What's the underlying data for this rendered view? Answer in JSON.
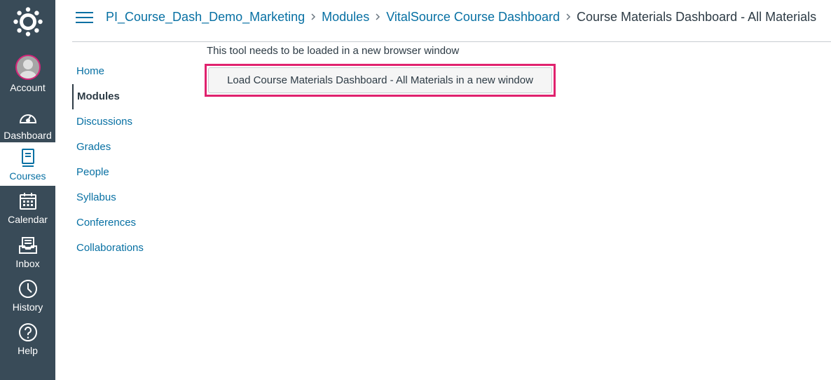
{
  "global_nav": {
    "items": [
      {
        "label": "Account",
        "icon": "avatar"
      },
      {
        "label": "Dashboard",
        "icon": "dashboard-icon"
      },
      {
        "label": "Courses",
        "icon": "courses-icon",
        "active": true
      },
      {
        "label": "Calendar",
        "icon": "calendar-icon"
      },
      {
        "label": "Inbox",
        "icon": "inbox-icon"
      },
      {
        "label": "History",
        "icon": "history-icon"
      },
      {
        "label": "Help",
        "icon": "help-icon"
      }
    ],
    "colors": {
      "background": "#394b58",
      "active_text": "#0770a3",
      "avatar_ring": "#d6257a"
    }
  },
  "breadcrumb": {
    "items": [
      "PI_Course_Dash_Demo_Marketing",
      "Modules",
      "VitalSource Course Dashboard"
    ],
    "current": "Course Materials Dashboard - All Materials"
  },
  "course_nav": {
    "items": [
      "Home",
      "Modules",
      "Discussions",
      "Grades",
      "People",
      "Syllabus",
      "Conferences",
      "Collaborations"
    ],
    "active": "Modules"
  },
  "main": {
    "message": "This tool needs to be loaded in a new browser window",
    "load_button_label": "Load Course Materials Dashboard - All Materials in a new window",
    "highlight_color": "#e0226e"
  },
  "colors": {
    "link": "#0770a3",
    "text": "#2d3b45"
  }
}
